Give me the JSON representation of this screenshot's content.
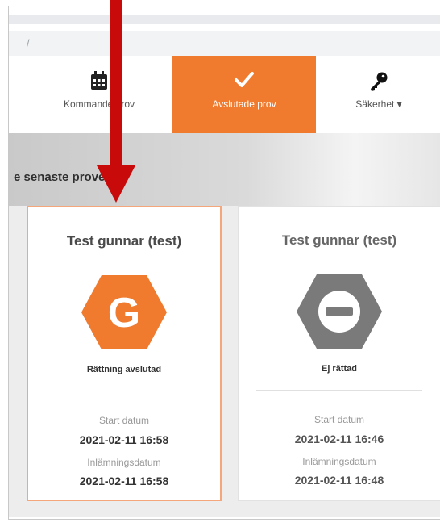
{
  "url": {
    "text": "/"
  },
  "nav": {
    "items": [
      {
        "label": "Kommande prov",
        "icon": "calendar-icon"
      },
      {
        "label": "Avslutade prov",
        "icon": "check-icon"
      },
      {
        "label": "Säkerhet ▾",
        "icon": "key-icon"
      }
    ]
  },
  "section": {
    "title": "e senaste proven"
  },
  "cards": [
    {
      "title": "Test gunnar (test)",
      "badge_letter": "G",
      "status": "Rättning avslutad",
      "start_label": "Start datum",
      "start_value": "2021-02-11 16:58",
      "submit_label": "Inlämningsdatum",
      "submit_value": "2021-02-11 16:58"
    },
    {
      "title": "Test gunnar (test)",
      "status": "Ej rättad",
      "start_label": "Start datum",
      "start_value": "2021-02-11 16:46",
      "submit_label": "Inlämningsdatum",
      "submit_value": "2021-02-11 16:48"
    }
  ],
  "colors": {
    "accent": "#f07b2e",
    "arrow": "#c80a0a",
    "badge_grey": "#7a7a7a"
  }
}
